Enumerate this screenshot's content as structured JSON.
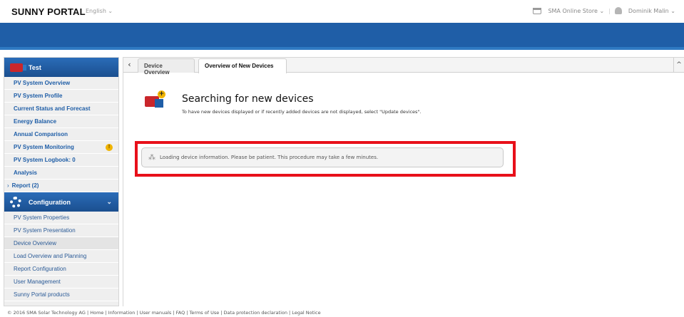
{
  "header": {
    "logo": "SUNNY PORTAL",
    "language": "English ⌄",
    "store": "SMA Online Store ⌄",
    "separator": "|",
    "user": "Dominik Malin ⌄"
  },
  "sidebar": {
    "system_name": "Test",
    "items": [
      {
        "label": "PV System Overview"
      },
      {
        "label": "PV System Profile"
      },
      {
        "label": "Current Status and Forecast"
      },
      {
        "label": "Energy Balance"
      },
      {
        "label": "Annual Comparison"
      },
      {
        "label": "PV System Monitoring",
        "warning": "!"
      },
      {
        "label": "PV System Logbook: 0"
      },
      {
        "label": "Analysis"
      },
      {
        "label": "Report (2)",
        "arrow": "›"
      }
    ],
    "config_title": "Configuration",
    "config_chevron": "⌄",
    "config_items": [
      {
        "label": "PV System Properties"
      },
      {
        "label": "PV System Presentation"
      },
      {
        "label": "Device Overview",
        "active": true
      },
      {
        "label": "Load Overview and Planning"
      },
      {
        "label": "Report Configuration"
      },
      {
        "label": "User Management"
      },
      {
        "label": "Sunny Portal products"
      }
    ]
  },
  "tabs": {
    "back": "‹",
    "items": [
      {
        "label": "Device Overview"
      },
      {
        "label": "Overview of New Devices",
        "active": true
      }
    ],
    "collapse": "^"
  },
  "content": {
    "title": "Searching for new devices",
    "description": "To have new devices displayed or if recently added devices are not displayed, select \"Update devices\".",
    "plus": "+",
    "loading_icon": "⁂",
    "loading_text": "Loading device information. Please be patient. This procedure may take a few minutes."
  },
  "footer": {
    "text": "© 2016 SMA Solar Technology AG   |  Home  |  Information  |  User manuals  |  FAQ  |  Terms of Use  |  Data protection declaration  |  Legal Notice"
  },
  "colors": {
    "brand_blue": "#1f5ea7",
    "highlight_red": "#e8101a",
    "warning_yellow": "#f0b400"
  }
}
